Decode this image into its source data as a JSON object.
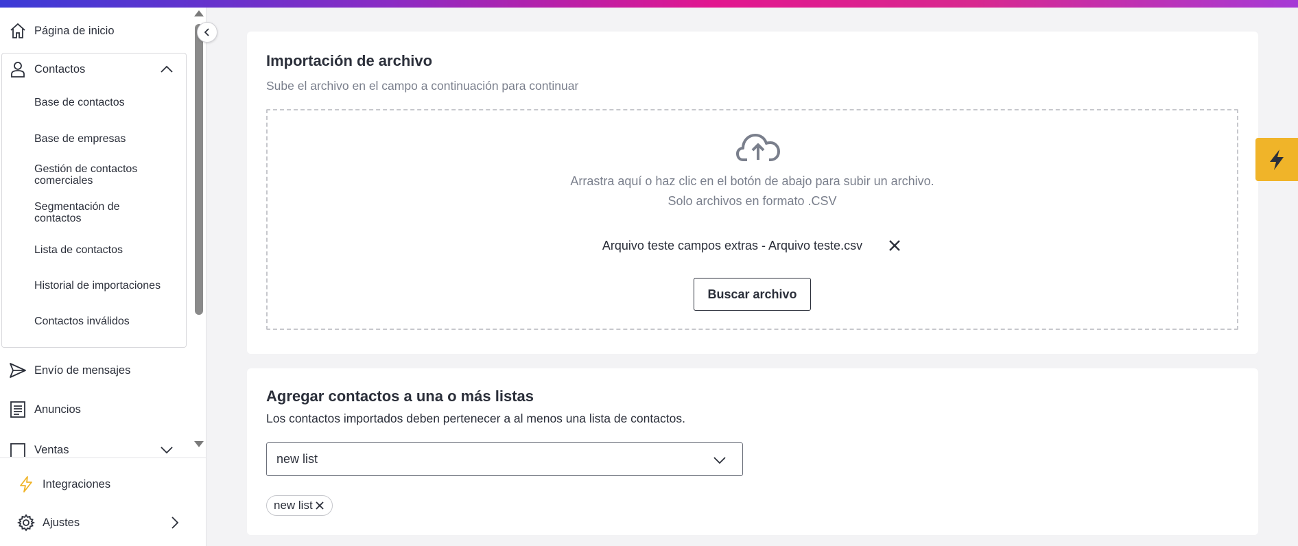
{
  "colors": {
    "accent_gradient": [
      "#3b3bd6",
      "#8a2bc4",
      "#e2168f",
      "#a63ad6"
    ],
    "text": "#2b2f3a",
    "muted": "#7a7f8c",
    "quick_action": "#f0b429"
  },
  "sidebar": {
    "home": {
      "label": "Página de inicio",
      "icon": "home-icon"
    },
    "contacts": {
      "label": "Contactos",
      "icon": "user-icon",
      "expanded": true,
      "items": [
        {
          "label": "Base de contactos"
        },
        {
          "label": "Base de empresas"
        },
        {
          "label": "Gestión de contactos comerciales"
        },
        {
          "label": "Segmentación de contactos"
        },
        {
          "label": "Lista de contactos"
        },
        {
          "label": "Historial de importaciones"
        },
        {
          "label": "Contactos inválidos"
        }
      ]
    },
    "messages": {
      "label": "Envío de mensajes",
      "icon": "send-icon"
    },
    "ads": {
      "label": "Anuncios",
      "icon": "document-icon"
    },
    "sales": {
      "label": "Ventas",
      "icon": "square-icon"
    },
    "integrations": {
      "label": "Integraciones",
      "icon": "lightning-icon"
    },
    "settings": {
      "label": "Ajustes",
      "icon": "gear-icon"
    }
  },
  "import_card": {
    "title": "Importación de archivo",
    "subtitle": "Sube el archivo en el campo a continuación para continuar",
    "drop_line1": "Arrastra aquí o haz clic en el botón de abajo para subir un archivo.",
    "drop_line2": "Solo archivos en formato .CSV",
    "file_name": "Arquivo teste campos extras - Arquivo teste.csv",
    "browse_label": "Buscar archivo"
  },
  "lists_card": {
    "title": "Agregar contactos a una o más listas",
    "subtitle": "Los contactos importados deben pertenecer a al menos una lista de contactos.",
    "select_value": "new list",
    "tags": [
      "new list"
    ]
  }
}
